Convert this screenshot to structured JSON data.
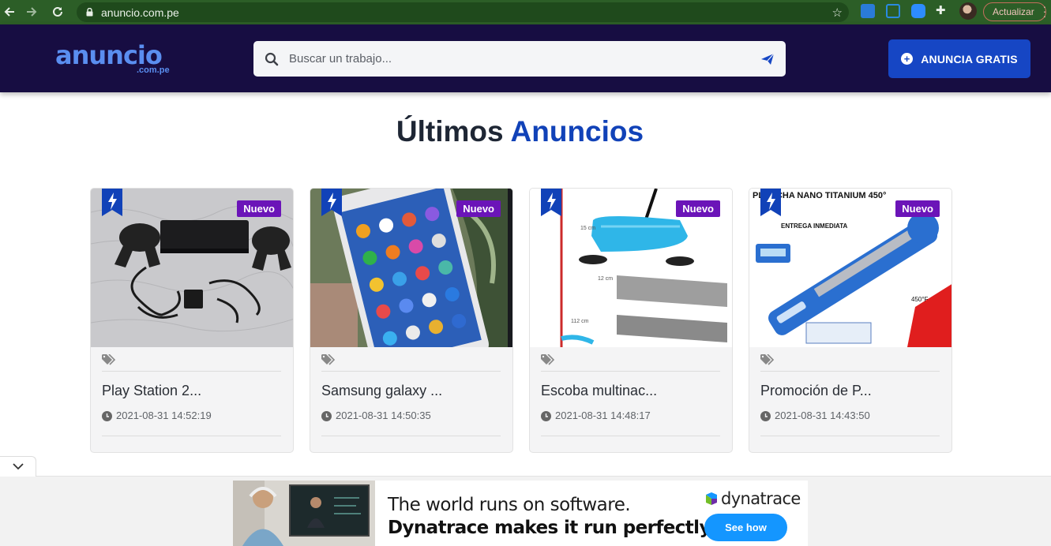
{
  "browser": {
    "url": "anuncio.com.pe",
    "update_label": "Actualizar"
  },
  "header": {
    "logo_main": "anuncio",
    "logo_sub": ".com.pe",
    "search_placeholder": "Buscar un trabajo...",
    "cta_label": "ANUNCIA GRATIS"
  },
  "section": {
    "title_part1": "Últimos",
    "title_part2": "Anuncios"
  },
  "listings": [
    {
      "badge": "Nuevo",
      "name": "Play Station 2...",
      "date": "2021-08-31 14:52:19"
    },
    {
      "badge": "Nuevo",
      "name": "Samsung galaxy ...",
      "date": "2021-08-31 14:50:35"
    },
    {
      "badge": "Nuevo",
      "name": "Escoba multinac...",
      "date": "2021-08-31 14:48:17"
    },
    {
      "badge": "Nuevo",
      "name": "Promoción de P...",
      "date": "2021-08-31 14:43:50"
    }
  ],
  "ad": {
    "line1": "The world runs on software.",
    "line2": "Dynatrace makes it run perfectly.",
    "brand": "dynatrace",
    "button": "See how"
  },
  "colors": {
    "header_bg": "#170d42",
    "accent_blue": "#1142b8",
    "cta_bg": "#1646c4",
    "badge_bg": "#6b14b8"
  }
}
